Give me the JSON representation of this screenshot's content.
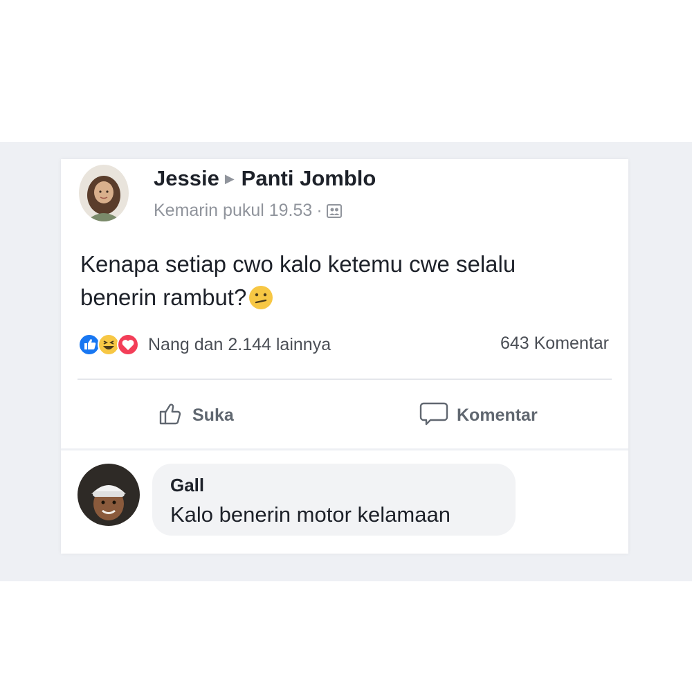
{
  "post": {
    "author": "Jessie",
    "group": "Panti Jomblo",
    "timestamp": "Kemarin pukul 19.53",
    "separator": "·",
    "privacy_icon": "group-members-icon",
    "text_line1": "Kenapa setiap cwo kalo ketemu cwe selalu",
    "text_line2": "benerin rambut?",
    "emoji": "confused-face-emoji",
    "reactions": {
      "icons": [
        "like-reaction-icon",
        "haha-reaction-icon",
        "love-reaction-icon"
      ],
      "summary": "Nang dan 2.144 lainnya"
    },
    "comment_count": "643 Komentar",
    "actions": {
      "like_label": "Suka",
      "comment_label": "Komentar"
    }
  },
  "comment": {
    "author": "Gall",
    "text": "Kalo benerin motor kelamaan"
  },
  "colors": {
    "like_blue": "#1877f2",
    "love_red": "#f33e58",
    "haha_yellow": "#f7c744",
    "text_primary": "#1d2129",
    "text_secondary": "#90949c"
  }
}
